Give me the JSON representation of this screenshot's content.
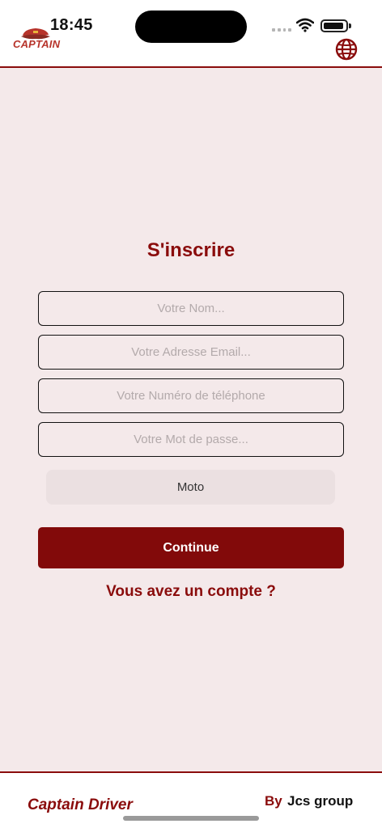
{
  "status_bar": {
    "time": "18:45"
  },
  "header": {
    "logo_text": "CAPTAIN",
    "logo_icon": "captain-hat-icon",
    "language_icon": "globe-icon"
  },
  "form": {
    "title": "S'inscrire",
    "name_placeholder": "Votre Nom...",
    "email_placeholder": "Votre Adresse Email...",
    "phone_placeholder": "Votre Numéro de téléphone",
    "password_placeholder": "Votre Mot de passe...",
    "vehicle_selected": "Moto",
    "continue_label": "Continue",
    "login_link": "Vous avez un compte ?"
  },
  "footer": {
    "brand": "Captain Driver",
    "by_label": "By",
    "company": "Jcs group"
  },
  "colors": {
    "accent": "#820a0a",
    "background": "#f4e9ea",
    "logo": "#b7342b"
  }
}
